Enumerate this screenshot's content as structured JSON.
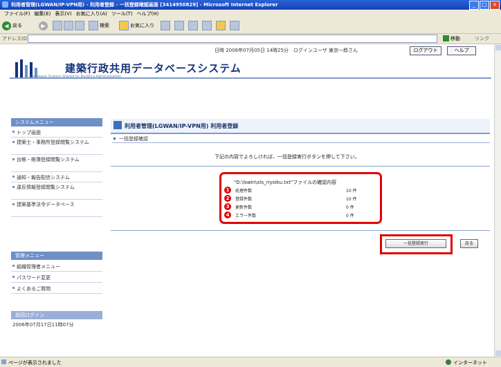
{
  "window": {
    "title": "利用者管理(LGWAN/IP-VPN用) - 利用者登録 - 一括登録確認画面 [3414950829] - Microsoft Internet Explorer"
  },
  "menubar": [
    "ファイル(F)",
    "編集(E)",
    "表示(V)",
    "お気に入り(A)",
    "ツール(T)",
    "ヘルプ(H)"
  ],
  "toolbar": {
    "back": "戻る",
    "search": "検索",
    "favorites": "お気に入り"
  },
  "address": {
    "label": "アドレス(D)",
    "go": "移動",
    "links": "リンク"
  },
  "header": {
    "info": "日時 2006年07月05日 14時25分　ログインユーザ 東京一郎さん",
    "logout": "ログアウト",
    "help": "ヘルプ",
    "system_title": "建築行政共用データベースシステム",
    "system_subtitle": "Database System Shared by Building Administration"
  },
  "sidebar": {
    "system_menu_heading": "システムメニュー",
    "items": [
      "トップ画面",
      "建築士・事務所登録閲覧システム",
      "台帳・帳簿登録閲覧システム",
      "通知・報告配信システム",
      "違反情報登録閲覧システム",
      "建築基準法令データベース"
    ],
    "admin_menu_heading": "管理メニュー",
    "admin_items": [
      "組織管理者メニュー",
      "パスワード変更",
      "よくあるご質問"
    ],
    "last_login_heading": "前回ログイン",
    "last_login_value": "2006年07月17日11時07分"
  },
  "main": {
    "title": "利用者管理(LGWAN/IP-VPN用) 利用者登録",
    "subtitle": "一括登録確認",
    "instruction": "下記の内容でよろしければ、一括登録実行ボタンを押して下さい。",
    "confirm_title": "\"D:\\lswin\\xls_riyoiku.txt\"ファイルの確認内容",
    "rows": [
      {
        "num": "1",
        "label": "処理件数",
        "value": "10 件"
      },
      {
        "num": "2",
        "label": "登録件数",
        "value": "10 件"
      },
      {
        "num": "3",
        "label": "更新件数",
        "value": "0 件"
      },
      {
        "num": "4",
        "label": "エラー件数",
        "value": "0 件"
      }
    ],
    "execute_button": "一括登録実行",
    "back_button": "戻る"
  },
  "status": {
    "left": "ページが表示されました",
    "zone": "インターネット"
  },
  "colors": {
    "highlight": "#e00000",
    "accent": "#6f8fc7",
    "title_blue": "#16327a"
  }
}
